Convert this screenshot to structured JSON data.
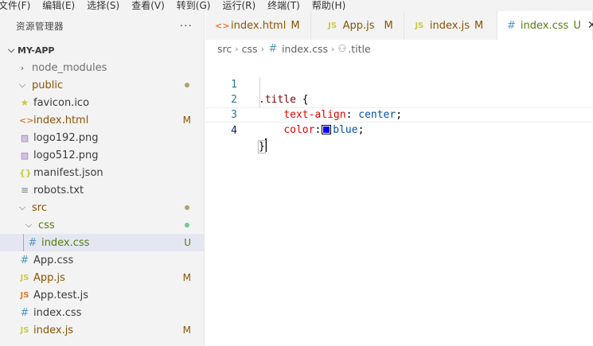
{
  "menubar": {
    "items": [
      "文件(F)",
      "编辑(E)",
      "选择(S)",
      "查看(V)",
      "转到(G)",
      "运行(R)",
      "终端(T)",
      "帮助(H)"
    ]
  },
  "explorer": {
    "title": "资源管理器",
    "more": "···",
    "project": "MY-APP",
    "rows": [
      {
        "label": "node_modules"
      },
      {
        "label": "public"
      },
      {
        "label": "favicon.ico"
      },
      {
        "label": "index.html",
        "badge": "M"
      },
      {
        "label": "logo192.png"
      },
      {
        "label": "logo512.png"
      },
      {
        "label": "manifest.json"
      },
      {
        "label": "robots.txt"
      },
      {
        "label": "src"
      },
      {
        "label": "css"
      },
      {
        "label": "index.css",
        "badge": "U"
      },
      {
        "label": "App.css"
      },
      {
        "label": "App.js",
        "badge": "M"
      },
      {
        "label": "App.test.js"
      },
      {
        "label": "index.css"
      },
      {
        "label": "index.js",
        "badge": "M"
      }
    ]
  },
  "tabs": [
    {
      "label": "index.html",
      "badge": "M"
    },
    {
      "label": "App.js",
      "badge": "M"
    },
    {
      "label": "index.js",
      "badge": "M"
    },
    {
      "label": "index.css",
      "badge": "U",
      "close": "✕"
    }
  ],
  "icons": {
    "js": "JS",
    "css": "#",
    "html": "<>",
    "json": "{}"
  },
  "breadcrumb": {
    "parts": [
      "src",
      "css",
      "index.css",
      ".title"
    ]
  },
  "editor": {
    "line_numbers": [
      "1",
      "2",
      "3",
      "4"
    ],
    "lines": {
      "l1_selector": ".title",
      "l1_brace": " {",
      "l2_prop": "text-align",
      "l2_colon": ": ",
      "l2_val": "center",
      "l2_semi": ";",
      "l3_prop": "color",
      "l3_colon": ":",
      "l3_val": "blue",
      "l3_semi": ";",
      "l4_brace": "}"
    }
  },
  "colors": {
    "modified": "#895503",
    "untracked": "#587c0c",
    "swatch": "#0000ff"
  }
}
